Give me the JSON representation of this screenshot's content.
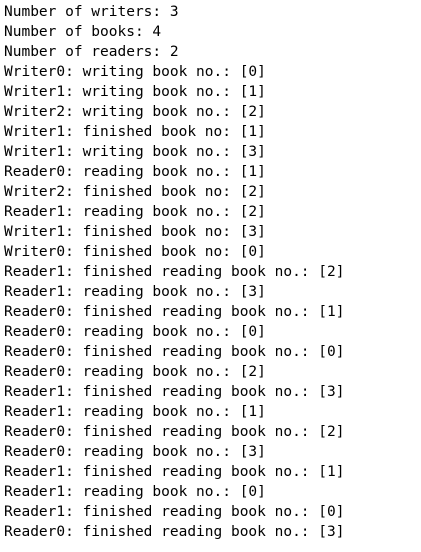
{
  "console": {
    "lines": [
      "Number of writers: 3",
      "Number of books: 4",
      "Number of readers: 2",
      "Writer0: writing book no.: [0]",
      "Writer1: writing book no.: [1]",
      "Writer2: writing book no.: [2]",
      "Writer1: finished book no: [1]",
      "Writer1: writing book no.: [3]",
      "Reader0: reading book no.: [1]",
      "Writer2: finished book no: [2]",
      "Reader1: reading book no.: [2]",
      "Writer1: finished book no: [3]",
      "Writer0: finished book no: [0]",
      "Reader1: finished reading book no.: [2]",
      "Reader1: reading book no.: [3]",
      "Reader0: finished reading book no.: [1]",
      "Reader0: reading book no.: [0]",
      "Reader0: finished reading book no.: [0]",
      "Reader0: reading book no.: [2]",
      "Reader1: finished reading book no.: [3]",
      "Reader1: reading book no.: [1]",
      "Reader0: finished reading book no.: [2]",
      "Reader0: reading book no.: [3]",
      "Reader1: finished reading book no.: [1]",
      "Reader1: reading book no.: [0]",
      "Reader1: finished reading book no.: [0]",
      "Reader0: finished reading book no.: [3]"
    ]
  }
}
